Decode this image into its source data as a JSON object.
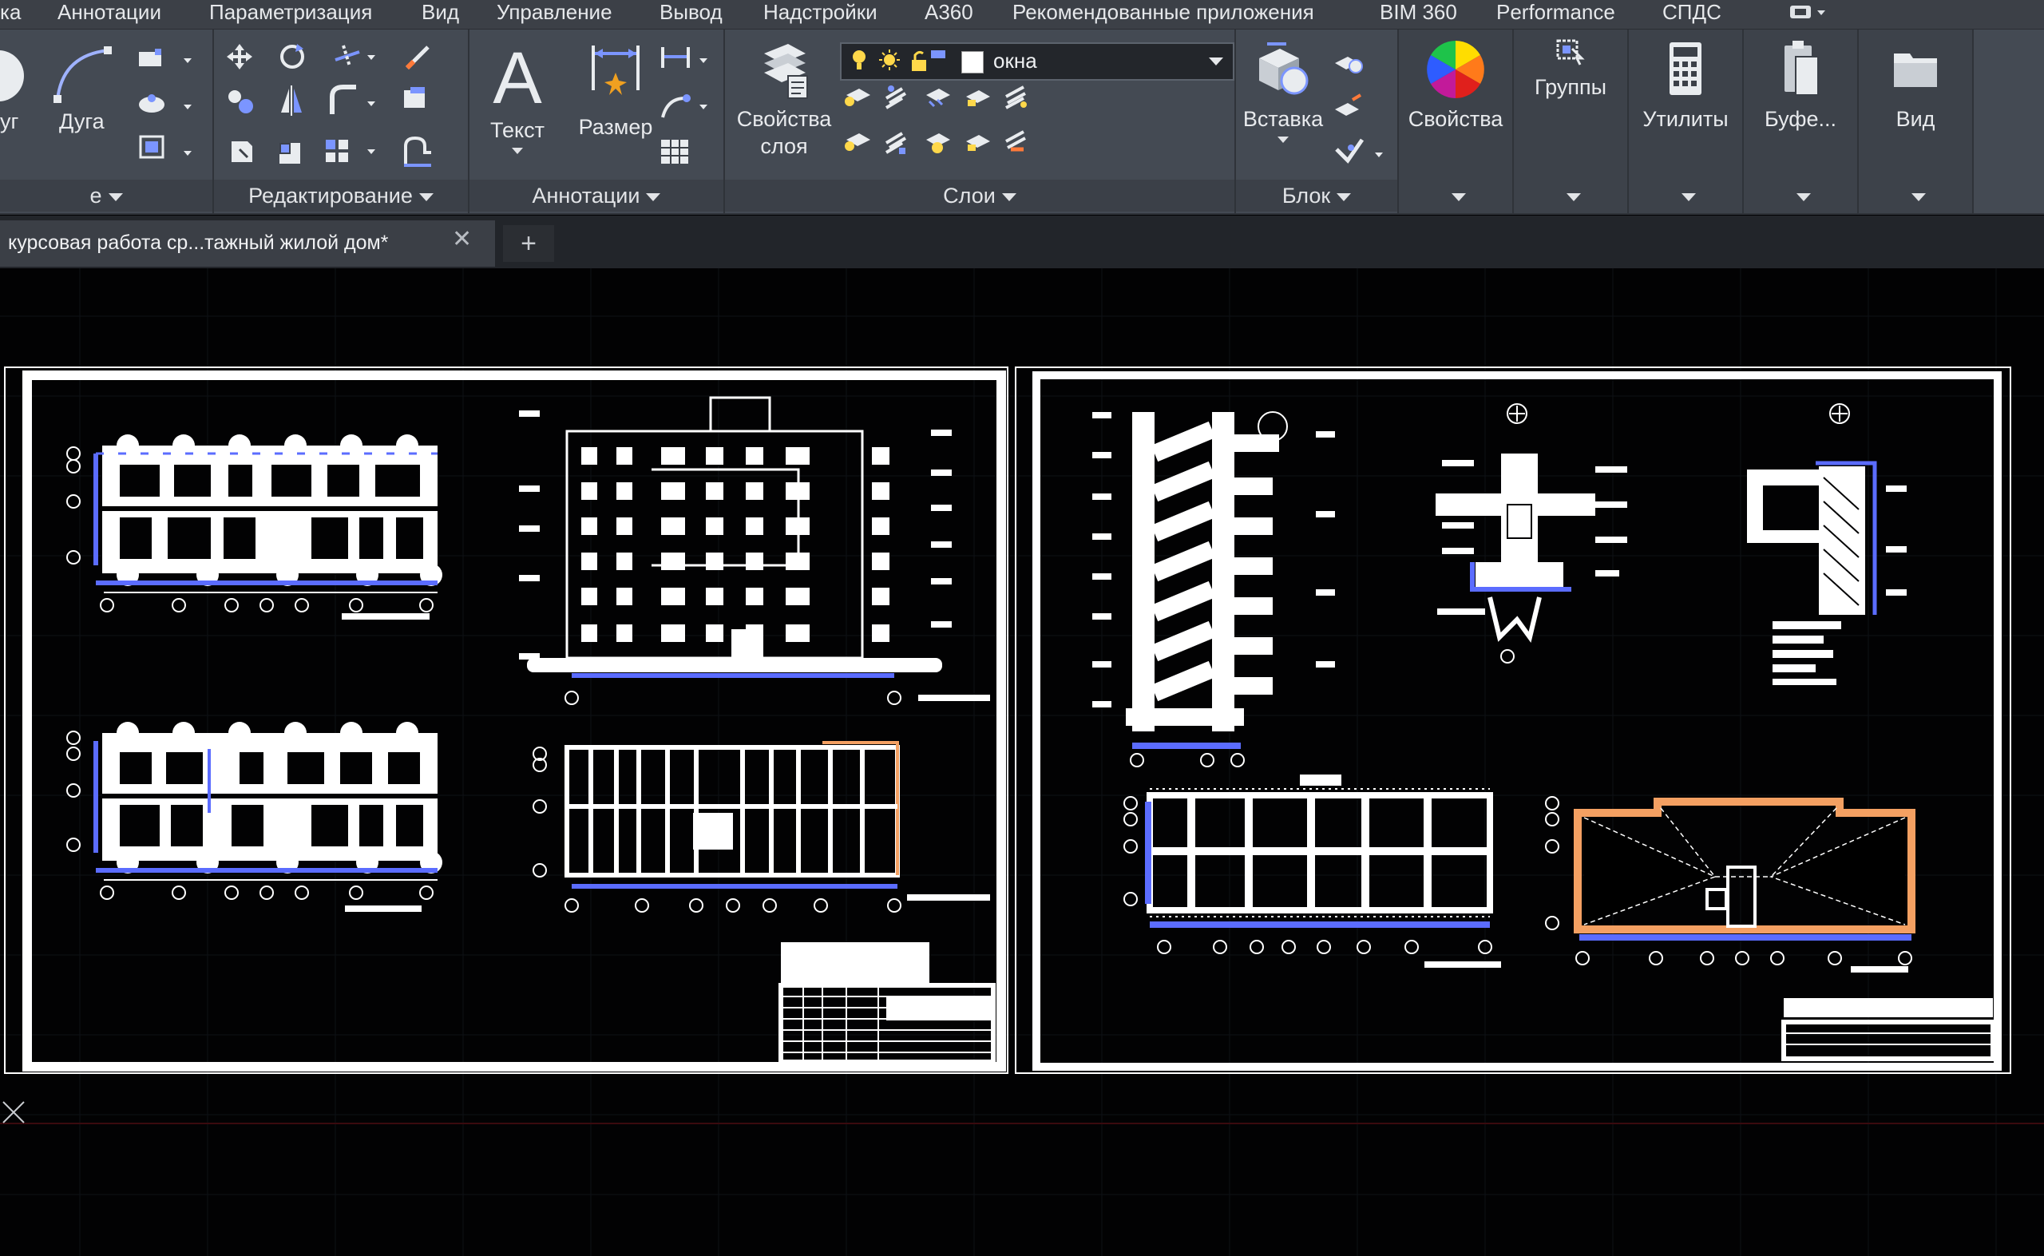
{
  "menu": {
    "tabs": [
      "ка",
      "Аннотации",
      "Параметризация",
      "Вид",
      "Управление",
      "Вывод",
      "Надстройки",
      "A360",
      "Рекомендованные приложения",
      "BIM 360",
      "Performance",
      "СПДС"
    ]
  },
  "ribbon": {
    "draw": {
      "circle_label": "уг",
      "arc_label": "Дуга",
      "title": "е"
    },
    "modify": {
      "title": "Редактирование"
    },
    "annotation": {
      "text_label": "Текст",
      "dimension_label": "Размер",
      "title": "Аннотации"
    },
    "layers": {
      "properties_label_1": "Свойства",
      "properties_label_2": "слоя",
      "current_layer": "окна",
      "title": "Слои"
    },
    "block": {
      "insert_label": "Вставка",
      "title": "Блок"
    },
    "properties": {
      "label": "Свойства"
    },
    "groups": {
      "label": "Группы"
    },
    "utilities": {
      "label": "Утилиты"
    },
    "clipboard": {
      "label": "Буфе..."
    },
    "view": {
      "label": "Вид"
    }
  },
  "documents": {
    "active_tab": "курсовая работа ср...тажный жилой дом*",
    "close_glyph": "✕",
    "new_glyph": "+"
  },
  "colors": {
    "menubar": "#3c4047",
    "ribbon": "#444a53",
    "canvas": "#020203",
    "drawing_white": "#ffffff",
    "dimension_blue": "#5b6cff",
    "highlight_orange": "#f4a062"
  }
}
